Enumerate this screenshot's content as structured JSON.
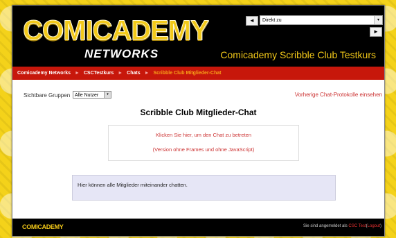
{
  "header": {
    "logo_main": "COMICADEMY",
    "logo_sub": "NETWORKS",
    "course_title": "Comicademy Scribble Club Testkurs",
    "jump_select": "Direkt zu",
    "prev_symbol": "◄",
    "next_symbol": "►",
    "dropdown_symbol": "▾"
  },
  "breadcrumb": {
    "items": [
      "Comicademy Networks",
      "CSCTestkurs",
      "Chats",
      "Scribble Club Mitglieder-Chat"
    ],
    "separator": "►"
  },
  "main": {
    "group_label": "Sichtbare Gruppen",
    "group_select": "Alle Nutzer",
    "prev_logs_link": "Vorherige Chat-Protokolle einsehen",
    "chat_title": "Scribble Club Mitglieder-Chat",
    "enter_link": "Klicken Sie hier, um den Chat zu betreten",
    "noframes_link": "(Version ohne Frames und ohne JavaScript)",
    "intro_text": "Hier können alle Mitglieder miteinander chatten."
  },
  "footer": {
    "logo": "COMICADEMY",
    "login_prefix": "Sie sind angemeldet als",
    "user": "CSC Test",
    "logout_open": "(",
    "logout": "Logout",
    "logout_close": ")"
  },
  "colors": {
    "brand_yellow": "#f3c919",
    "nav_red": "#c7170b",
    "link_red": "#cc3333",
    "intro_bg": "#e6e6f6"
  }
}
